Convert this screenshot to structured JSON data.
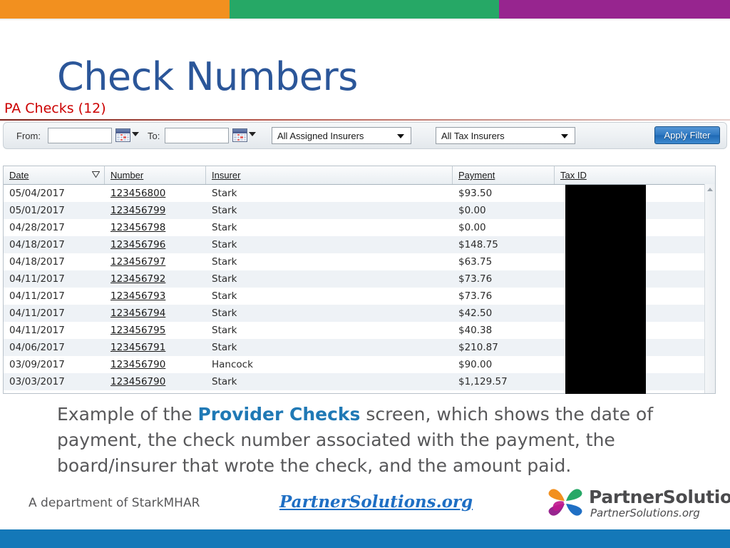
{
  "topbar": {
    "segment_colors": [
      "#f2901f",
      "#26a866",
      "#97258f"
    ]
  },
  "slide": {
    "title": "Check Numbers",
    "title_color": "#2b5699"
  },
  "screenshot": {
    "window_title": "PA Checks (12)",
    "window_title_color": "#cc0000",
    "filter": {
      "from_label": "From:",
      "from_value": "",
      "to_label": "To:",
      "to_value": "",
      "from_calendar_icon": "calendar-icon",
      "to_calendar_icon": "calendar-icon",
      "assigned_insurers_select": "All Assigned Insurers",
      "tax_insurers_select": "All Tax Insurers",
      "apply_button": "Apply Filter"
    },
    "table": {
      "columns": [
        "Date",
        "Number",
        "Insurer",
        "Payment",
        "Tax ID"
      ],
      "sort_column": "Date",
      "sort_direction": "descending",
      "rows": [
        {
          "date": "05/04/2017",
          "number": "123456800",
          "insurer": "Stark",
          "payment": "$93.50",
          "tax_id": ""
        },
        {
          "date": "05/01/2017",
          "number": "123456799",
          "insurer": "Stark",
          "payment": "$0.00",
          "tax_id": ""
        },
        {
          "date": "04/28/2017",
          "number": "123456798",
          "insurer": "Stark",
          "payment": "$0.00",
          "tax_id": ""
        },
        {
          "date": "04/18/2017",
          "number": "123456796",
          "insurer": "Stark",
          "payment": "$148.75",
          "tax_id": ""
        },
        {
          "date": "04/18/2017",
          "number": "123456797",
          "insurer": "Stark",
          "payment": "$63.75",
          "tax_id": ""
        },
        {
          "date": "04/11/2017",
          "number": "123456792",
          "insurer": "Stark",
          "payment": "$73.76",
          "tax_id": ""
        },
        {
          "date": "04/11/2017",
          "number": "123456793",
          "insurer": "Stark",
          "payment": "$73.76",
          "tax_id": ""
        },
        {
          "date": "04/11/2017",
          "number": "123456794",
          "insurer": "Stark",
          "payment": "$42.50",
          "tax_id": ""
        },
        {
          "date": "04/11/2017",
          "number": "123456795",
          "insurer": "Stark",
          "payment": "$40.38",
          "tax_id": ""
        },
        {
          "date": "04/06/2017",
          "number": "123456791",
          "insurer": "Stark",
          "payment": "$210.87",
          "tax_id": ""
        },
        {
          "date": "03/09/2017",
          "number": "123456790",
          "insurer": "Hancock",
          "payment": "$90.00",
          "tax_id": ""
        },
        {
          "date": "03/03/2017",
          "number": "123456790",
          "insurer": "Stark",
          "payment": "$1,129.57",
          "tax_id": ""
        }
      ]
    },
    "scrollbar": {
      "up_arrow_icon": "scroll-up-arrow-icon"
    }
  },
  "caption": {
    "part1": "Example of the ",
    "highlight": "Provider Checks",
    "part2": " screen, which shows the date of payment, the check number associated with the payment, the board/insurer that wrote the check, and the amount paid.",
    "highlight_color": "#2079b5"
  },
  "footer": {
    "department": "A department of StarkMHAR",
    "site_link": "PartnerSolutions.org",
    "logo_name": "PartnerSolutions",
    "logo_tagline": "PartnerSolutions.org",
    "logo_mark_colors": [
      "#f2901f",
      "#26a866",
      "#97258f",
      "#1f6fc4",
      "#c0198f"
    ],
    "bottom_bar_color": "#1478b8"
  }
}
